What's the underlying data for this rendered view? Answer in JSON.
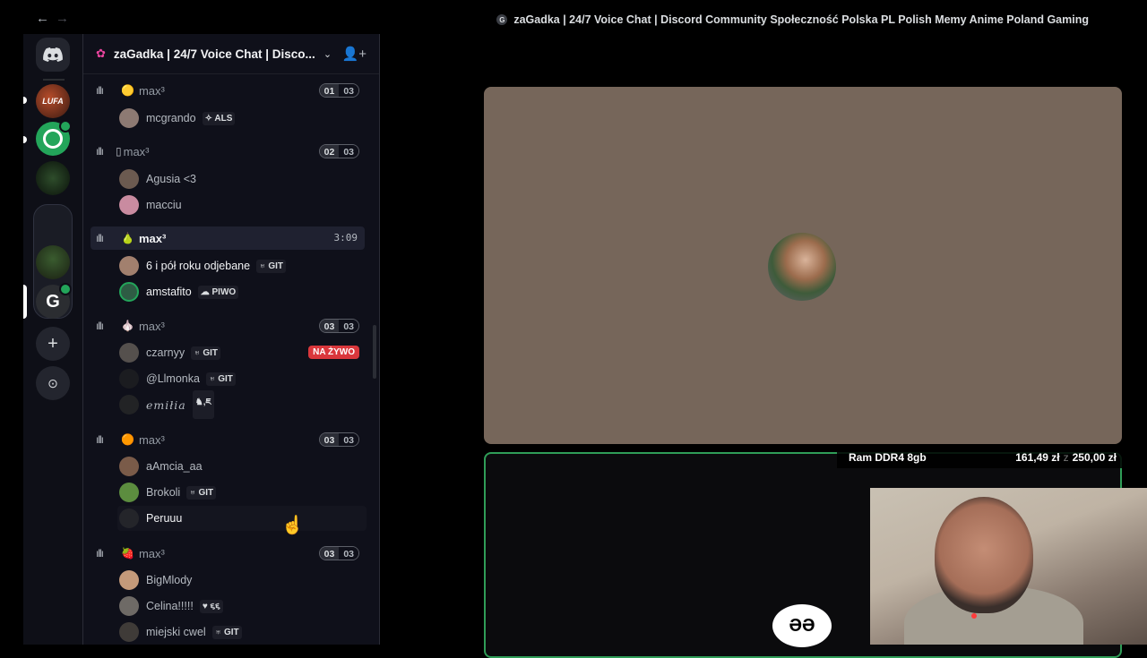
{
  "browser": {
    "back_icon": "←",
    "forward_icon": "→",
    "favicon_letter": "G",
    "title": "zaGadka | 24/7 Voice Chat | Discord Community Społeczność Polska PL Polish Memy Anime Poland Gaming"
  },
  "rail": {
    "lufa_label": "LUFA",
    "g_label": "G",
    "add_icon": "+",
    "explore_icon": "⊙"
  },
  "server": {
    "icon": "✿",
    "name": "zaGadka | 24/7 Voice Chat | Disco...",
    "chevron": "⌄",
    "invite_icon": "👤+"
  },
  "voice_channels": [
    {
      "emoji": "🟡",
      "name": "max³",
      "count_current": "01",
      "count_max": "03",
      "users": [
        {
          "name": "mcgrando",
          "tag": "✧ ALS"
        }
      ]
    },
    {
      "emoji": "▯",
      "name": "max³",
      "count_current": "02",
      "count_max": "03",
      "users": [
        {
          "name": "Agusia <3",
          "tag": ""
        },
        {
          "name": "macciu",
          "tag": ""
        }
      ]
    },
    {
      "emoji": "🍐",
      "name": "max³",
      "timer": "3:09",
      "users": [
        {
          "name": "6 i pół roku odjebane",
          "tag": "♅ GIT"
        },
        {
          "name": "amstafito",
          "tag": "☁ PIWO"
        }
      ]
    },
    {
      "emoji": "🧄",
      "name": "max³",
      "count_current": "03",
      "count_max": "03",
      "live_label": "NA ŻYWO",
      "users": [
        {
          "name": "czarnyy",
          "tag": "♅ GIT"
        },
        {
          "name": "@Llmonka",
          "tag": "♅ GIT"
        },
        {
          "name": "emiłia",
          "tag": "♞,ཇ"
        }
      ]
    },
    {
      "emoji": "🟠",
      "name": "max³",
      "count_current": "03",
      "count_max": "03",
      "users": [
        {
          "name": "aAmcia_aa",
          "tag": ""
        },
        {
          "name": "Brokoli",
          "tag": "♅ GIT"
        },
        {
          "name": "Peruuu",
          "tag": ""
        }
      ]
    },
    {
      "emoji": "🍓",
      "name": "max³",
      "count_current": "03",
      "count_max": "03",
      "users": [
        {
          "name": "BigMlody",
          "tag": ""
        },
        {
          "name": "Celina!!!!!",
          "tag": "♥ ૬૬"
        },
        {
          "name": "miejski cwel",
          "tag": "♅ GIT"
        }
      ]
    }
  ],
  "stream": {
    "overlay_item": "Ram DDR4 8gb",
    "overlay_price": "161,49 zł",
    "overlay_sep": "z",
    "overlay_goal": "250,00 zł",
    "logo_text": "ӘӘ"
  },
  "colors": {
    "accent_green": "#2f9d57",
    "live_red": "#da373c",
    "tile_bg": "#76665a"
  }
}
